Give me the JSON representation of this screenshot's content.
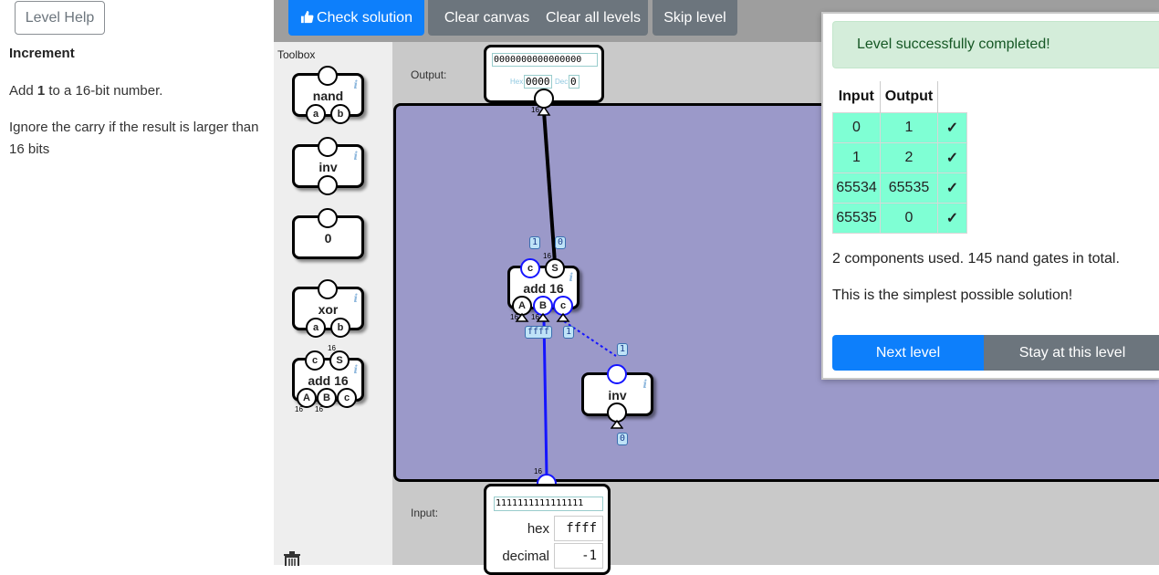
{
  "help": {
    "button_label": "Level Help",
    "title": "Increment",
    "p1_pre": "Add ",
    "p1_bold": "1",
    "p1_post": " to a 16-bit number.",
    "p2": "Ignore the carry if the result is larger than 16 bits"
  },
  "toolbar": {
    "check": "Check solution",
    "clear_canvas": "Clear canvas",
    "clear_levels": "Clear all levels",
    "skip": "Skip level"
  },
  "toolbox": {
    "label": "Toolbox",
    "items": {
      "nand": {
        "label": "nand",
        "pins": [
          "a",
          "b"
        ]
      },
      "inv": {
        "label": "inv"
      },
      "zero": {
        "label": "0"
      },
      "xor": {
        "label": "xor",
        "pins": [
          "a",
          "b"
        ]
      },
      "add16": {
        "label": "add 16",
        "outs": [
          "c",
          "S"
        ],
        "ins": [
          "A",
          "B",
          "c"
        ],
        "width": "16"
      }
    },
    "info_glyph": "i"
  },
  "canvas": {
    "output_label": "Output:",
    "input_label": "Input:",
    "output": {
      "bits": "0000000000000000",
      "hex_label": "Hex",
      "hex": "0000",
      "dec_label": "Dec",
      "dec": "0"
    },
    "input": {
      "bits": "1111111111111111",
      "hex_label": "hex",
      "hex": "ffff",
      "dec_label": "decimal",
      "dec": "-1"
    },
    "add16": {
      "label": "add 16",
      "out_c": "c",
      "out_s": "S",
      "in_a": "A",
      "in_b": "B",
      "in_c": "c"
    },
    "inv": {
      "label": "inv"
    },
    "tags": {
      "carry_out": "1",
      "sum_out": "0",
      "a_in": "ffff",
      "c_in": "1",
      "inv_out_top": "1",
      "inv_in": "0"
    },
    "width": "16"
  },
  "result": {
    "success": "Level successfully completed!",
    "headers": [
      "Input",
      "Output"
    ],
    "check": "✓",
    "rows": [
      {
        "input": "0",
        "output": "1"
      },
      {
        "input": "1",
        "output": "2"
      },
      {
        "input": "65534",
        "output": "65535"
      },
      {
        "input": "65535",
        "output": "0"
      }
    ],
    "components_text": "2 components used. 145 nand gates in total.",
    "simplest_text": "This is the simplest possible solution!",
    "next": "Next level",
    "stay": "Stay at this level"
  },
  "colors": {
    "primary": "#0d7ffb",
    "secondary": "#6c757d",
    "board": "#9b99c9",
    "pass": "#7fffd4",
    "wire_active": "#1515ff"
  }
}
